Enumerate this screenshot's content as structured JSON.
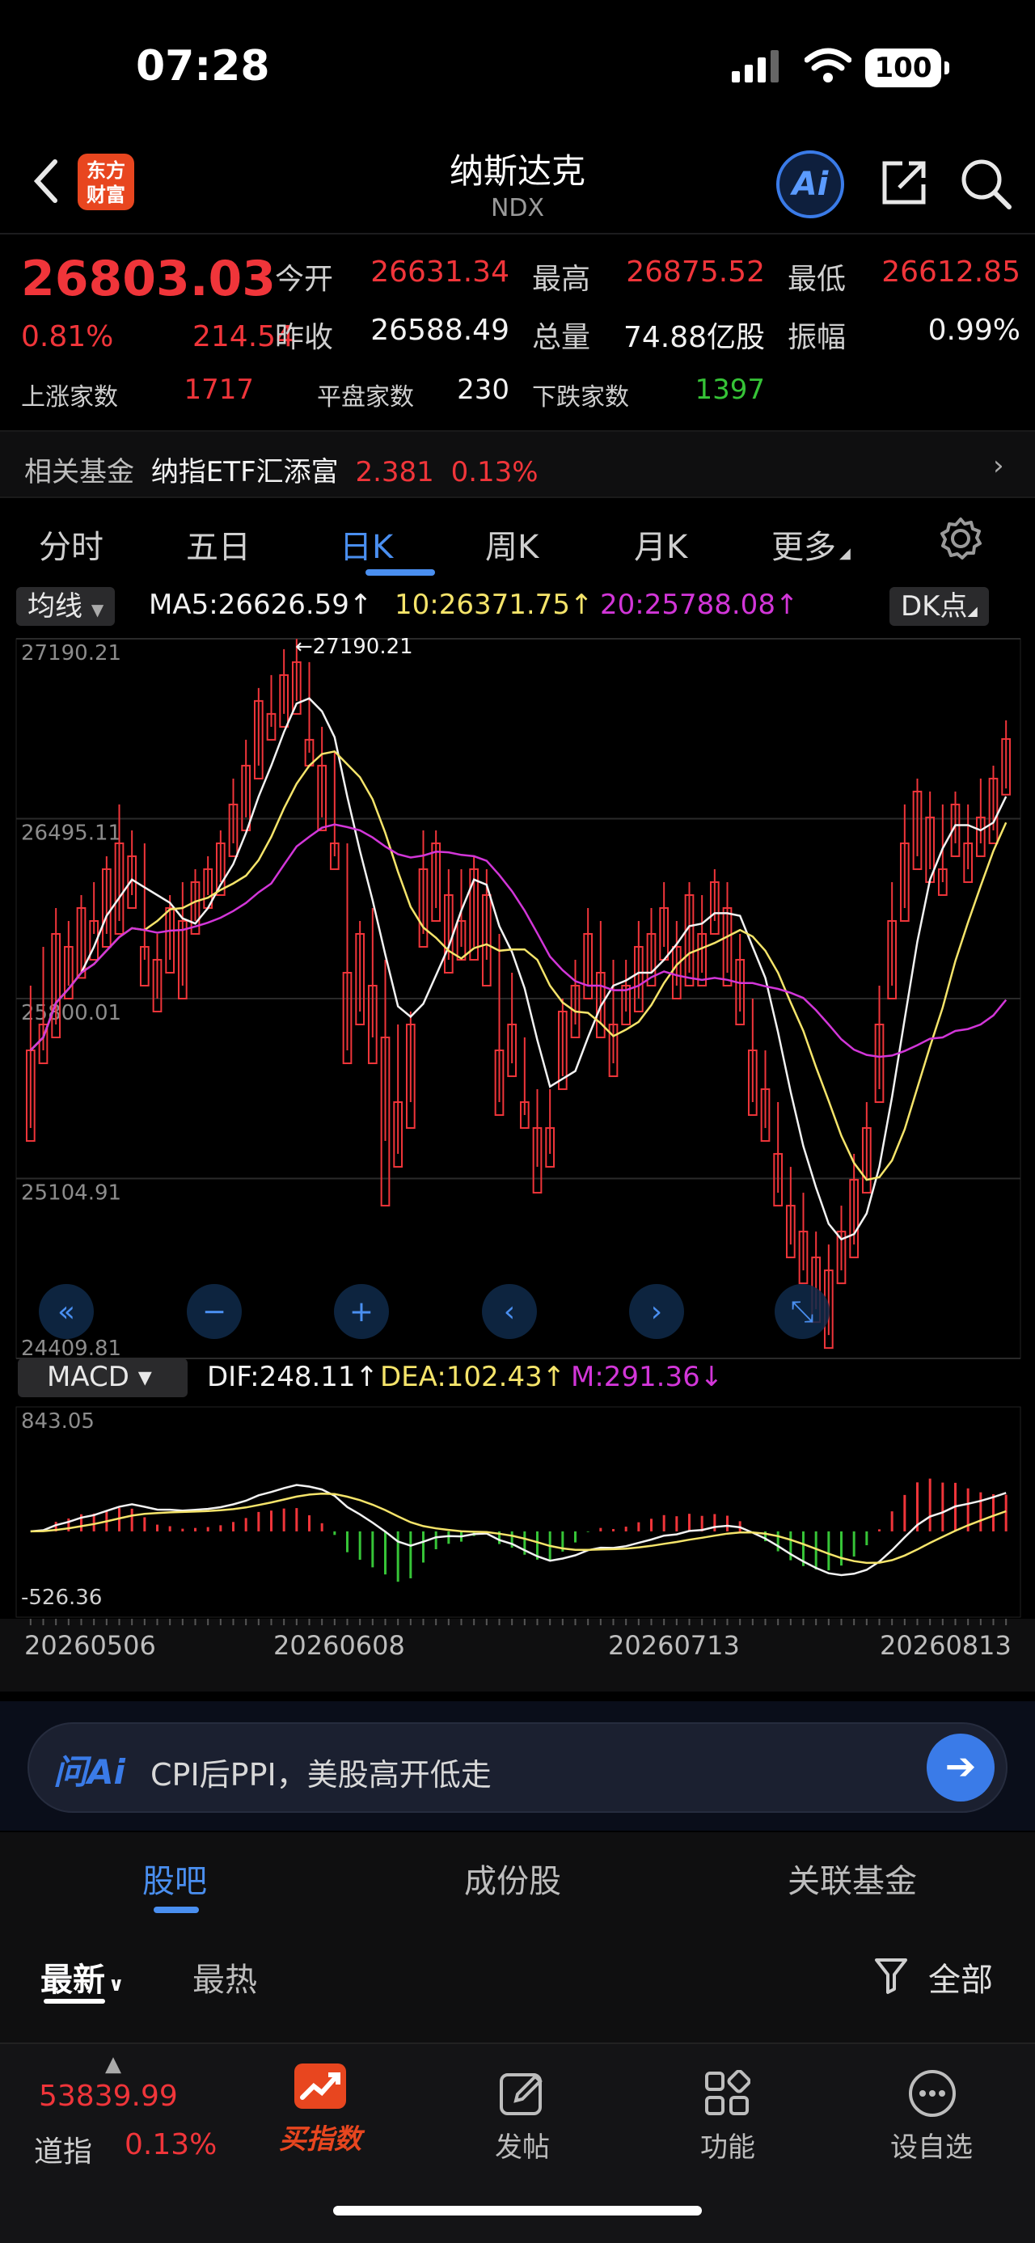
{
  "status": {
    "time": "07:28",
    "battery": "100"
  },
  "nav": {
    "logo_text": "东方\n财富",
    "title": "纳斯达克",
    "subtitle": "NDX",
    "ai_label": "Ai"
  },
  "quote": {
    "price": "26803.03",
    "pct": "0.81%",
    "change": "214.54",
    "rows": [
      [
        {
          "l": "今开",
          "v": "26631.34",
          "c": "red"
        },
        {
          "l": "最高",
          "v": "26875.52",
          "c": "red"
        },
        {
          "l": "最低",
          "v": "26612.85",
          "c": "red"
        }
      ],
      [
        {
          "l": "昨收",
          "v": "26588.49",
          "c": "white"
        },
        {
          "l": "总量",
          "v": "74.88亿股",
          "c": "white"
        },
        {
          "l": "振幅",
          "v": "0.99%",
          "c": "white"
        }
      ]
    ],
    "breadth": [
      {
        "l": "上涨家数",
        "v": "1717",
        "c": "red"
      },
      {
        "l": "平盘家数",
        "v": "230",
        "c": "white"
      },
      {
        "l": "下跌家数",
        "v": "1397",
        "c": "green"
      }
    ]
  },
  "fund": {
    "label": "相关基金",
    "name": "纳指ETF汇添富",
    "price": "2.381",
    "pct": "0.13%"
  },
  "tabs": [
    {
      "label": "分时",
      "active": false
    },
    {
      "label": "五日",
      "active": false
    },
    {
      "label": "日K",
      "active": true
    },
    {
      "label": "周K",
      "active": false
    },
    {
      "label": "月K",
      "active": false
    },
    {
      "label": "更多",
      "active": false
    }
  ],
  "chart_data": {
    "type": "candlestick",
    "indicator_select": "均线",
    "ma_legend": [
      {
        "text": "MA5:26626.59↑",
        "color": "#f2f2f2"
      },
      {
        "text": "10:26371.75↑",
        "color": "#f5e46a"
      },
      {
        "text": "20:25788.08↑",
        "color": "#d236d8"
      }
    ],
    "dk_label": "DK点",
    "price_ticks": [
      "27190.21",
      "26495.11",
      "25800.01",
      "25104.91",
      "24409.81"
    ],
    "ylim": [
      24409.81,
      27190.21
    ],
    "high_marker": "27190.21",
    "low_marker": "24409.81",
    "macd_select": "MACD",
    "macd_legend": [
      {
        "text": "DIF:248.11↑",
        "color": "#f2f2f2"
      },
      {
        "text": "DEA:102.43↑",
        "color": "#f5e46a"
      },
      {
        "text": "M:291.36↓",
        "color": "#d236d8"
      }
    ],
    "macd_ticks": [
      "843.05",
      "-526.36"
    ],
    "macd_ylim": [
      -526.36,
      843.05
    ],
    "date_ticks": [
      "20260506",
      "20260608",
      "20260713",
      "20260813"
    ],
    "candles": [
      [
        25600,
        25850,
        25300,
        25250
      ],
      [
        25700,
        26000,
        25600,
        25550
      ],
      [
        26050,
        26150,
        25700,
        25650
      ],
      [
        26000,
        26100,
        25850,
        25800
      ],
      [
        26150,
        26200,
        25900,
        25880
      ],
      [
        26100,
        26250,
        26050,
        25950
      ],
      [
        26300,
        26350,
        26050,
        26000
      ],
      [
        26400,
        26550,
        26100,
        26050
      ],
      [
        26350,
        26450,
        26200,
        26150
      ],
      [
        26000,
        26400,
        25950,
        25850
      ],
      [
        25950,
        26050,
        25800,
        25750
      ],
      [
        26150,
        26200,
        25950,
        25900
      ],
      [
        26100,
        26250,
        25850,
        25800
      ],
      [
        26250,
        26300,
        26100,
        26050
      ],
      [
        26300,
        26350,
        26200,
        26150
      ],
      [
        26400,
        26450,
        26250,
        26200
      ],
      [
        26550,
        26650,
        26400,
        26350
      ],
      [
        26700,
        26800,
        26500,
        26450
      ],
      [
        26950,
        27000,
        26700,
        26650
      ],
      [
        26900,
        27050,
        26850,
        26800
      ],
      [
        27050,
        27150,
        26900,
        26850
      ],
      [
        27100,
        27190,
        26950,
        26900
      ],
      [
        26800,
        27100,
        26750,
        26700
      ],
      [
        26700,
        26850,
        26500,
        26450
      ],
      [
        26400,
        26750,
        26350,
        26300
      ],
      [
        25900,
        26400,
        25600,
        25550
      ],
      [
        26050,
        26100,
        25750,
        25700
      ],
      [
        25850,
        26150,
        25650,
        25550
      ],
      [
        25650,
        25950,
        25250,
        25000
      ],
      [
        25400,
        25700,
        25200,
        25150
      ],
      [
        25700,
        25750,
        25400,
        25300
      ],
      [
        26300,
        26450,
        26050,
        26000
      ],
      [
        26400,
        26450,
        26150,
        26100
      ],
      [
        26200,
        26300,
        25950,
        25900
      ],
      [
        26100,
        26300,
        26000,
        25950
      ],
      [
        26300,
        26350,
        26000,
        25950
      ],
      [
        26200,
        26300,
        25950,
        25850
      ],
      [
        25600,
        26050,
        25400,
        25350
      ],
      [
        25700,
        25900,
        25550,
        25500
      ],
      [
        25400,
        25650,
        25350,
        25300
      ],
      [
        25300,
        25450,
        25150,
        25050
      ],
      [
        25300,
        25450,
        25200,
        25150
      ],
      [
        25750,
        25800,
        25500,
        25450
      ],
      [
        25850,
        25950,
        25700,
        25650
      ],
      [
        26050,
        26150,
        25850,
        25800
      ],
      [
        25900,
        26100,
        25700,
        25650
      ],
      [
        25700,
        25950,
        25550,
        25500
      ],
      [
        25850,
        25950,
        25750,
        25700
      ],
      [
        26000,
        26100,
        25800,
        25750
      ],
      [
        26050,
        26150,
        25900,
        25850
      ],
      [
        26150,
        26250,
        26000,
        25950
      ],
      [
        26000,
        26100,
        25850,
        25800
      ],
      [
        26200,
        26250,
        25900,
        25850
      ],
      [
        26050,
        26200,
        25900,
        25850
      ],
      [
        26250,
        26300,
        26100,
        26050
      ],
      [
        26150,
        26250,
        25900,
        25850
      ],
      [
        25950,
        26050,
        25750,
        25700
      ],
      [
        25600,
        25800,
        25400,
        25350
      ],
      [
        25450,
        25600,
        25300,
        25250
      ],
      [
        25200,
        25400,
        25050,
        25000
      ],
      [
        25000,
        25150,
        24850,
        24800
      ],
      [
        24900,
        25050,
        24750,
        24700
      ],
      [
        24800,
        24900,
        24600,
        24550
      ],
      [
        24750,
        24850,
        24500,
        24450
      ],
      [
        24900,
        25000,
        24750,
        24700
      ],
      [
        25100,
        25200,
        24850,
        24800
      ],
      [
        25300,
        25400,
        25100,
        25050
      ],
      [
        25700,
        25850,
        25450,
        25400
      ],
      [
        26100,
        26250,
        25850,
        25800
      ],
      [
        26400,
        26550,
        26150,
        26100
      ],
      [
        26600,
        26650,
        26350,
        26300
      ],
      [
        26500,
        26600,
        26300,
        26250
      ],
      [
        26300,
        26550,
        26250,
        26200
      ],
      [
        26550,
        26600,
        26400,
        26350
      ],
      [
        26400,
        26550,
        26300,
        26250
      ],
      [
        26500,
        26650,
        26400,
        26350
      ],
      [
        26650,
        26700,
        26450,
        26400
      ],
      [
        26803,
        26875,
        26612,
        26588
      ]
    ]
  },
  "aibar": {
    "brand": "问Ai",
    "text": "CPI后PPI，美股高开低走"
  },
  "subtabs": [
    {
      "label": "股吧",
      "active": true
    },
    {
      "label": "成份股",
      "active": false
    },
    {
      "label": "关联基金",
      "active": false
    }
  ],
  "filters": {
    "latest": "最新",
    "hot": "最热",
    "all": "全部"
  },
  "footer": {
    "index_value": "53839.99",
    "index_name": "道指",
    "index_pct": "0.13%",
    "buy_label": "买指数",
    "items": [
      {
        "label": "发帖"
      },
      {
        "label": "功能"
      },
      {
        "label": "设自选"
      }
    ]
  }
}
